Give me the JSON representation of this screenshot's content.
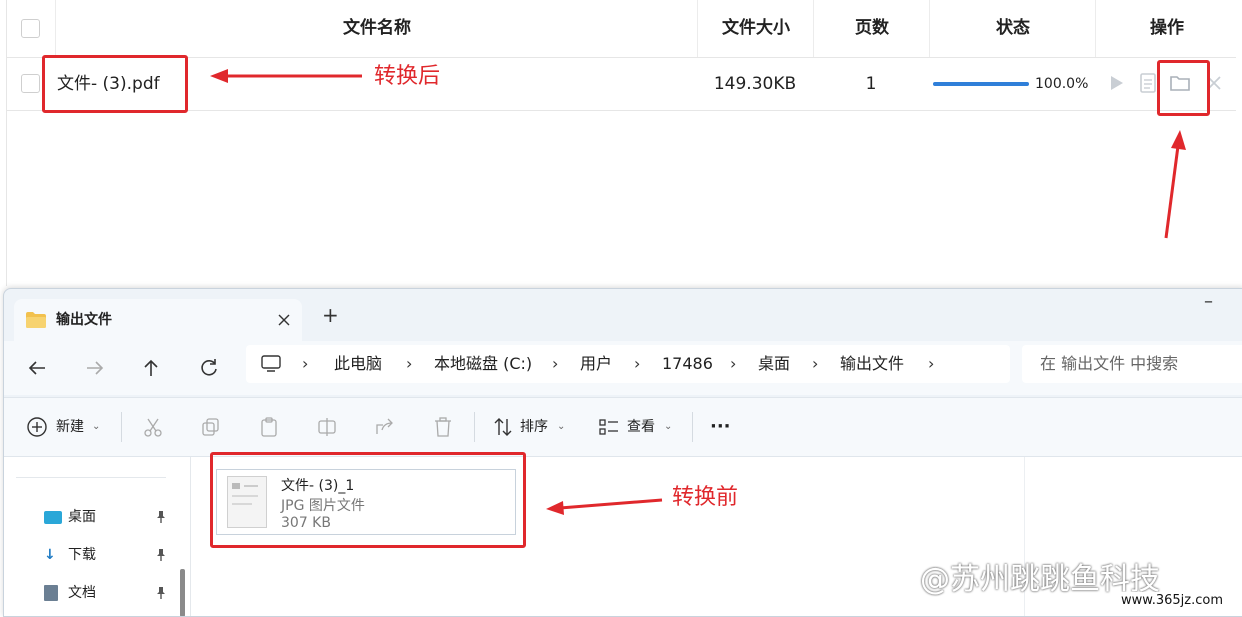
{
  "table": {
    "headers": {
      "filename": "文件名称",
      "size": "文件大小",
      "pages": "页数",
      "status": "状态",
      "actions": "操作"
    },
    "rows": [
      {
        "filename": "文件- (3).pdf",
        "size": "149.30KB",
        "pages": "1",
        "progress": 1.0,
        "progress_text": "100.0%"
      }
    ]
  },
  "annotations": {
    "after": "转换后",
    "before": "转换前",
    "color": "#e0282c"
  },
  "explorer": {
    "tab_title": "输出文件",
    "new_tab": "+",
    "minimize": "–",
    "breadcrumbs": [
      "此电脑",
      "本地磁盘 (C:)",
      "用户",
      "17486",
      "桌面",
      "输出文件"
    ],
    "search_placeholder": "在 输出文件 中搜索",
    "toolbar": {
      "new": "新建",
      "sort": "排序",
      "view": "查看",
      "more": "···"
    },
    "sidebar": [
      "桌面",
      "下载",
      "文档"
    ],
    "file": {
      "name": "文件- (3)_1",
      "type": "JPG 图片文件",
      "size": "307 KB"
    }
  },
  "watermark": {
    "text": "@苏州跳跳鱼科技",
    "url": "www.365jz.com"
  },
  "icons": [
    "checkbox-icon",
    "play-icon",
    "document-icon",
    "folder-icon",
    "close-icon",
    "back-icon",
    "forward-icon",
    "up-icon",
    "refresh-icon",
    "computer-icon",
    "cut-icon",
    "copy-icon",
    "paste-icon",
    "rename-icon",
    "share-icon",
    "delete-icon",
    "sort-icon",
    "view-icon",
    "pin-icon"
  ]
}
